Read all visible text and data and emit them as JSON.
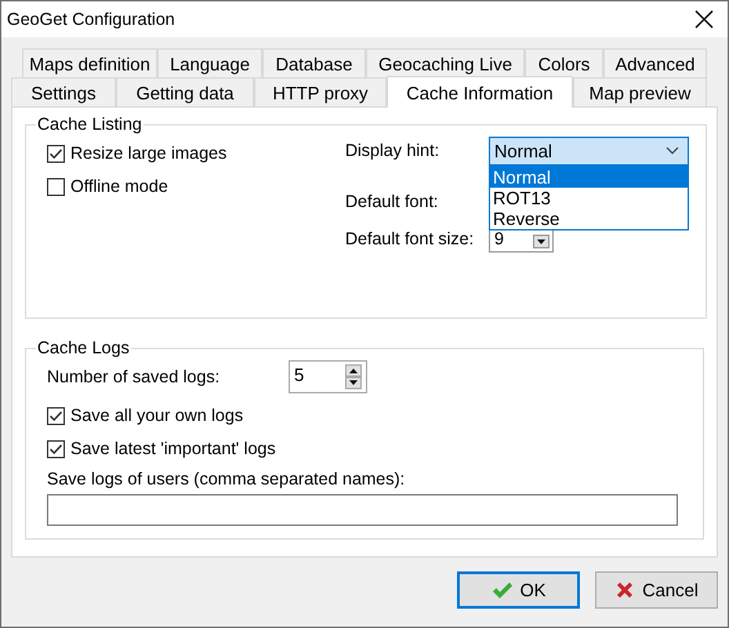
{
  "window": {
    "title": "GeoGet Configuration"
  },
  "tab_rows": [
    {
      "tabs": [
        {
          "label": "Maps definition",
          "selected": false
        },
        {
          "label": "Language",
          "selected": false
        },
        {
          "label": "Database",
          "selected": false
        },
        {
          "label": "Geocaching Live",
          "selected": false
        },
        {
          "label": "Colors",
          "selected": false
        },
        {
          "label": "Advanced",
          "selected": false
        }
      ]
    },
    {
      "tabs": [
        {
          "label": "Settings",
          "selected": false
        },
        {
          "label": "Getting data",
          "selected": false
        },
        {
          "label": "HTTP proxy",
          "selected": false
        },
        {
          "label": "Cache Information",
          "selected": true
        },
        {
          "label": "Map preview",
          "selected": false
        }
      ]
    }
  ],
  "cache_listing": {
    "title": "Cache Listing",
    "checkboxes": [
      {
        "label": "Resize large images",
        "checked": true
      },
      {
        "label": "Offline mode",
        "checked": false
      }
    ],
    "display_hint": {
      "label": "Display hint:",
      "value": "Normal",
      "expanded": true,
      "options": [
        {
          "label": "Normal",
          "selected": true
        },
        {
          "label": "ROT13",
          "selected": false
        },
        {
          "label": "Reverse",
          "selected": false
        }
      ]
    },
    "default_font": {
      "label": "Default font:"
    },
    "default_font_size": {
      "label": "Default font size:",
      "value": "9"
    }
  },
  "cache_logs": {
    "title": "Cache Logs",
    "saved_logs": {
      "label": "Number of saved logs:",
      "value": "5"
    },
    "checkboxes": [
      {
        "label": "Save all your own logs",
        "checked": true
      },
      {
        "label": "Save latest 'important' logs",
        "checked": true
      }
    ],
    "users": {
      "label": "Save logs of users (comma separated names):"
    }
  },
  "buttons": [
    {
      "label": "OK",
      "kind": "ok"
    },
    {
      "label": "Cancel",
      "kind": "cancel"
    }
  ]
}
